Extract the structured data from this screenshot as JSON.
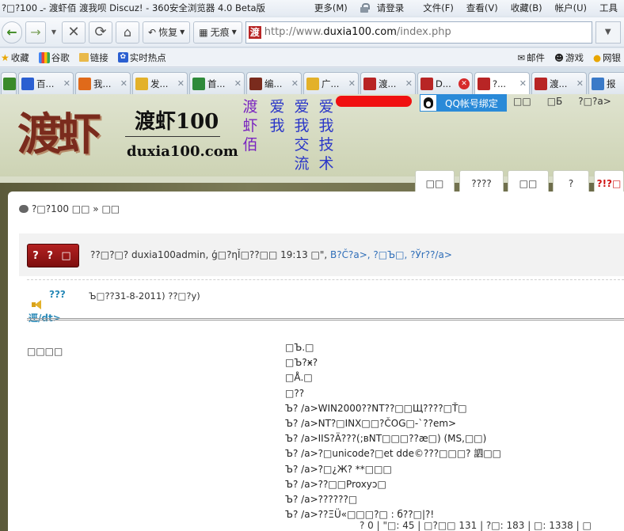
{
  "browser": {
    "window_title": "?□?100 ـ- 渡虾佰 渡我呗 Discuz! - 360安全浏览器 4.0 Beta版",
    "menu": [
      "更多(M)",
      "请登录",
      "文件(F)",
      "查看(V)",
      "收藏(B)",
      "帐户(U)",
      "工具"
    ],
    "restore_label": "恢复",
    "traceless_label": "无痕",
    "url_prefix": "http://www.",
    "url_domain": "duxia100.com",
    "url_path": "/index.php",
    "favorites": [
      "收藏",
      "谷歌",
      "链接",
      "实时热点"
    ],
    "favorites_right": [
      "邮件",
      "游戏",
      "网银"
    ],
    "tabs": [
      {
        "label": "",
        "icon": "page-icon",
        "color": "#3a8a2a"
      },
      {
        "label": "百...",
        "icon": "baidu-paw-icon",
        "color": "#2b5fd1"
      },
      {
        "label": "我...",
        "icon": "shield-icon",
        "color": "#e06a1a"
      },
      {
        "label": "发...",
        "icon": "speech-bubble-icon",
        "color": "#e3b12a"
      },
      {
        "label": "首...",
        "icon": "ie-icon",
        "color": "#2f8a3a"
      },
      {
        "label": "编...",
        "icon": "b-icon",
        "color": "#7a2b1d"
      },
      {
        "label": "广...",
        "icon": "speech-bubble-icon",
        "color": "#e3b12a"
      },
      {
        "label": "渡...",
        "icon": "du-icon",
        "color": "#b82525"
      },
      {
        "label": "D...",
        "icon": "du-icon",
        "color": "#b82525"
      },
      {
        "label": "?...",
        "icon": "du-icon",
        "color": "#b82525"
      },
      {
        "label": "渡...",
        "icon": "du-icon",
        "color": "#b82525"
      },
      {
        "label": "报",
        "icon": "chart-icon",
        "color": "#3a7ac8"
      }
    ]
  },
  "site": {
    "logo_char": "渡虾",
    "logo_name": "渡虾100",
    "logo_url": "duxia100.com",
    "slogan_cols": [
      "渡虾佰",
      "爱我",
      "爱我交流",
      "爱我技术"
    ],
    "qq_bind": "QQ帐号绑定",
    "toplinks": [
      "□□",
      "□Б",
      "?□?a>"
    ],
    "nav_tabs": [
      "□□",
      "????",
      "□□",
      "?",
      "?!?□"
    ]
  },
  "thread": {
    "breadcrumb": "?□?100 □□ » □□",
    "reply_button": "? ? □",
    "meta_text": "??□?□? duxia100admin, ǵ□?ηǏ□??□□ 19:13 □\", ",
    "meta_links": "В?Č?a>, ?□Ъ□, ?Ўr??/a>",
    "row_label": "???",
    "row_value": "Ъ□??31-8-2011) ??□?y)",
    "dt_text": "逕/dt>",
    "left_label": "□□□□",
    "lines": [
      "□Ъ.□",
      "□Ъ?ӿ?",
      "□Å.□",
      "□??",
      "Ъ?   /a>WIN2000??NT??□□Щ????□Ť□",
      "Ъ?   /a>NT?□INX□□?ČOG□-`??em>",
      "Ъ?   /a>IIS?Ä???(;вNT□□□??ӕ□) (MS,□□)",
      "Ъ?   /a>?□unicode?□et dde©???□□□?   訵□□",
      "Ъ?   /a>?□¿Ж? **□□□",
      "Ъ?   /a>??□□Proxyɔ□",
      "Ъ?   /a>??????□",
      "Ъ?   /a>??ΞÜ«□□□?□ : б??□|?!"
    ],
    "footer_stats": "?     0 | \"□: 45 | □?□□  131 | ?□: 183 | □: 1338 | □"
  }
}
